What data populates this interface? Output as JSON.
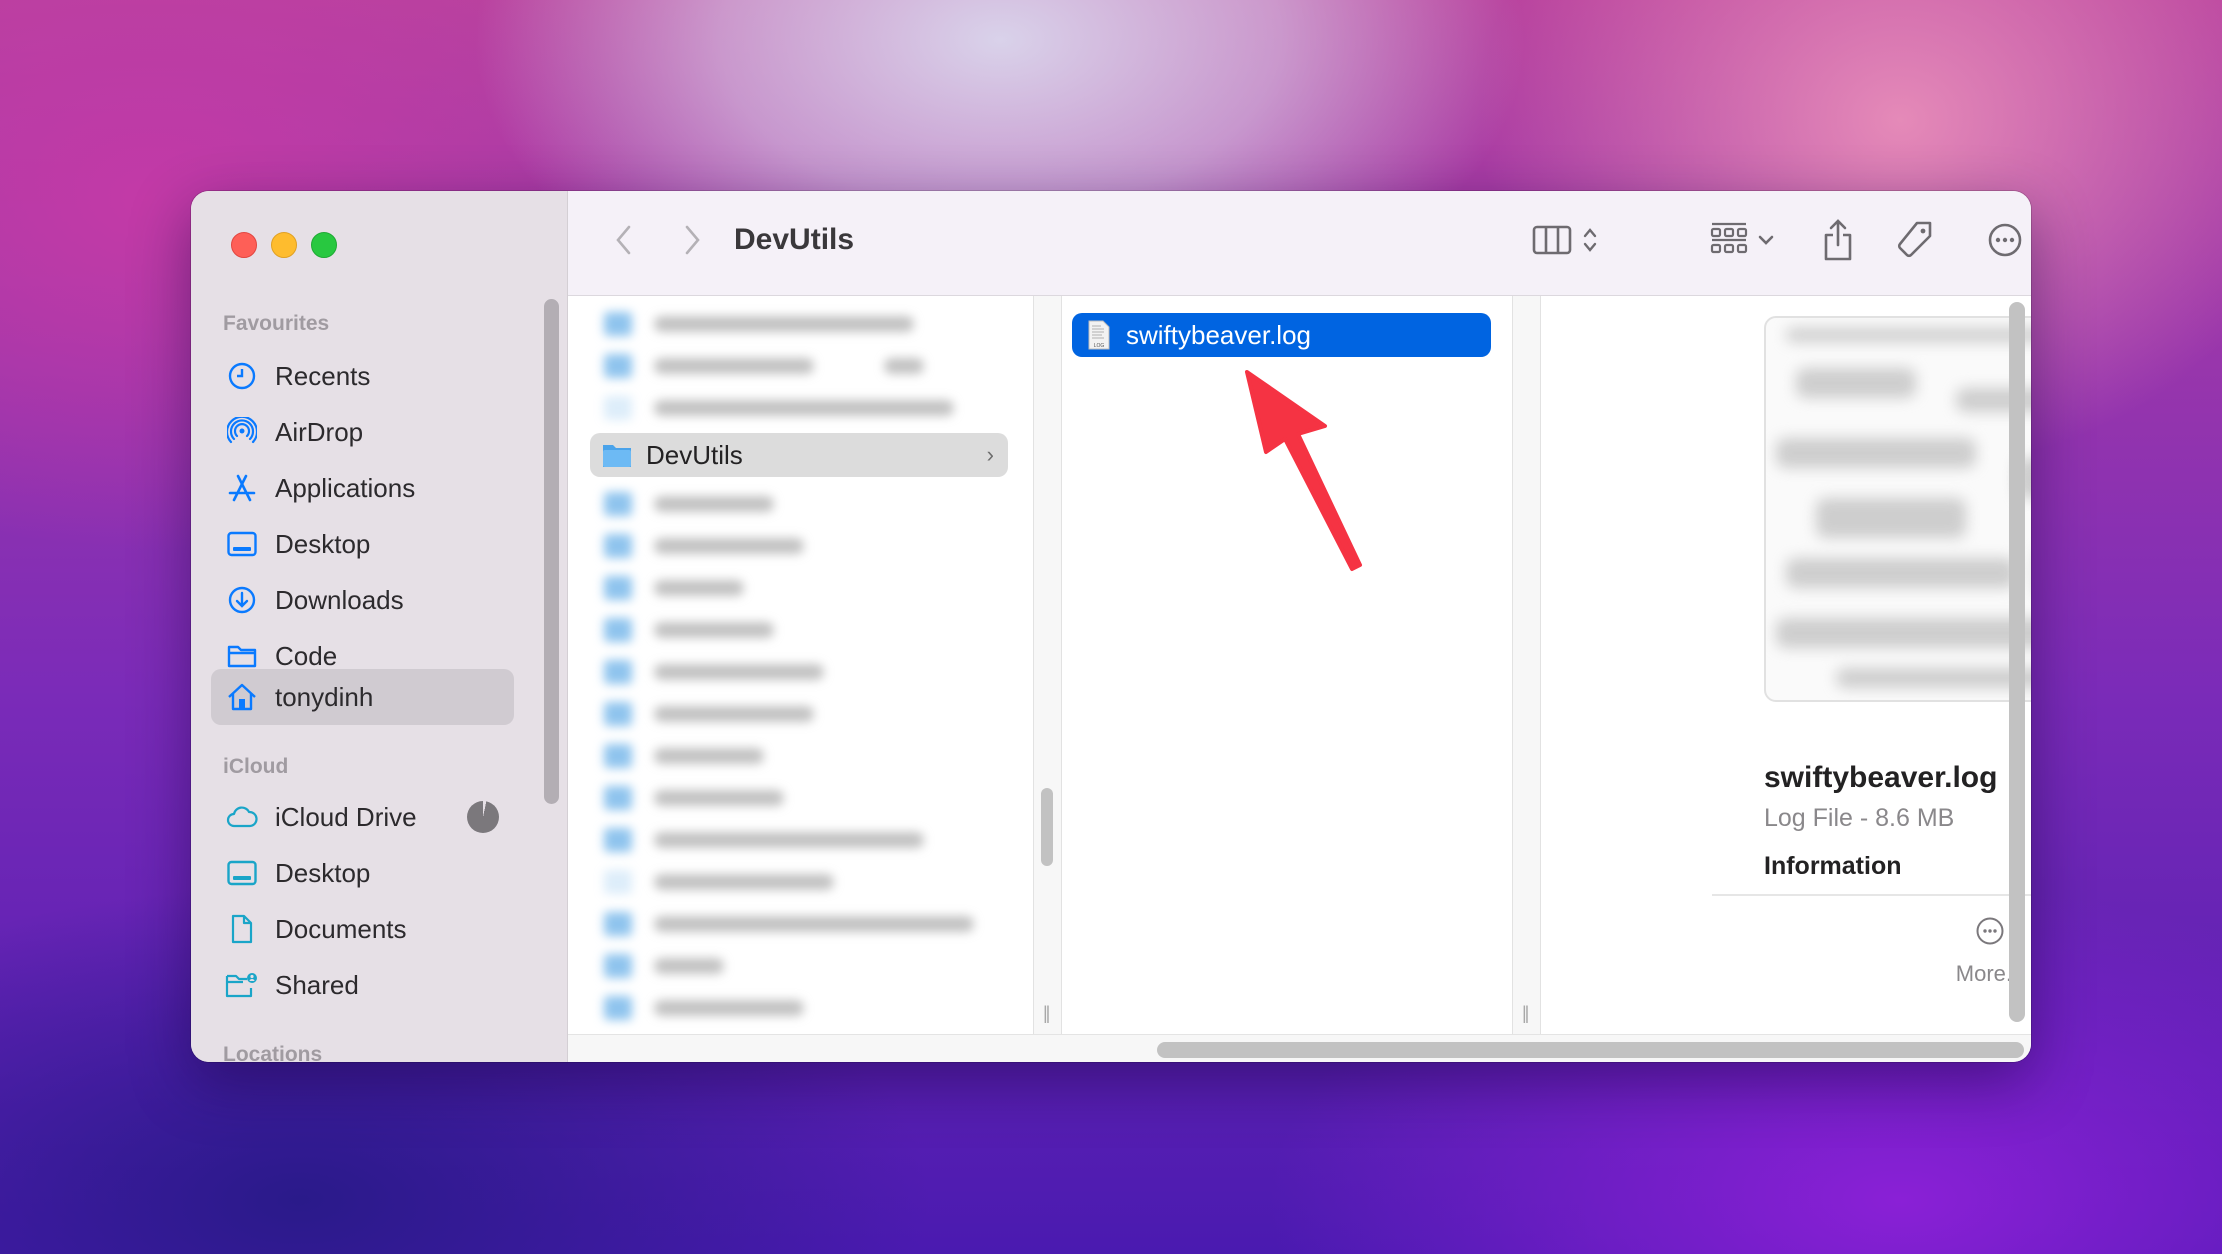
{
  "window": {
    "title": "DevUtils"
  },
  "sidebar": {
    "sections": [
      {
        "label": "Favourites"
      },
      {
        "label": "iCloud"
      },
      {
        "label": "Locations"
      }
    ],
    "favourites": [
      {
        "label": "Recents",
        "icon": "clock-icon"
      },
      {
        "label": "AirDrop",
        "icon": "airdrop-icon"
      },
      {
        "label": "Applications",
        "icon": "applications-icon"
      },
      {
        "label": "Desktop",
        "icon": "desktop-icon"
      },
      {
        "label": "Downloads",
        "icon": "downloads-icon"
      },
      {
        "label": "Code",
        "icon": "folder-icon"
      },
      {
        "label": "tonydinh",
        "icon": "home-icon",
        "selected": true
      }
    ],
    "icloud": [
      {
        "label": "iCloud Drive",
        "icon": "cloud-icon",
        "status": "syncing"
      },
      {
        "label": "Desktop",
        "icon": "desktop-icon"
      },
      {
        "label": "Documents",
        "icon": "document-icon"
      },
      {
        "label": "Shared",
        "icon": "shared-folder-icon"
      }
    ],
    "accent_color": "#0a7aff",
    "icloud_color": "#1aa5c8"
  },
  "toolbar": {
    "back": "back-chevron-icon",
    "forward": "forward-chevron-icon",
    "title": "DevUtils",
    "view_mode": "columns-view-icon",
    "group": "group-grid-icon",
    "share": "share-icon",
    "tag": "tag-icon",
    "actions": "more-actions-icon",
    "search": "search-icon"
  },
  "columns": {
    "col1": {
      "selected_item": "DevUtils",
      "other_items_redacted": true
    },
    "col2": {
      "items": [
        {
          "name": "swiftybeaver.log",
          "icon_label": "LOG",
          "selected": true
        }
      ]
    }
  },
  "preview": {
    "file_name": "swiftybeaver.log",
    "kind_size": "Log File - 8.6 MB",
    "section_heading": "Information",
    "more_label": "More..."
  },
  "annotation": {
    "arrow_color": "#f53343"
  },
  "colors": {
    "selection_blue": "#0064e1",
    "sidebar_bg": "#e6e0e6"
  }
}
